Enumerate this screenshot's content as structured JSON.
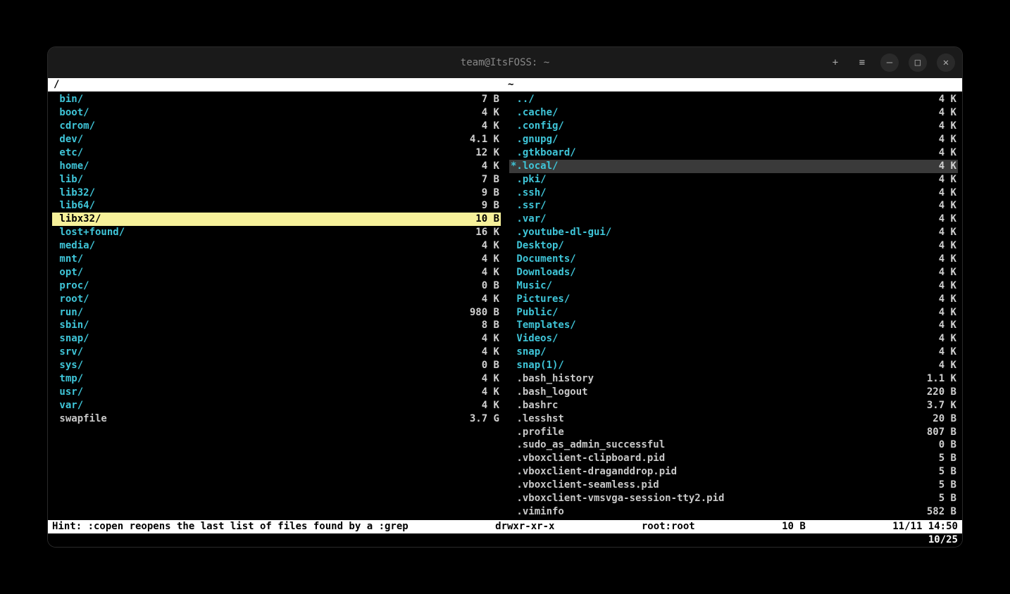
{
  "window": {
    "title": "team@ItsFOSS: ~"
  },
  "titlebar_icons": {
    "new_tab": "+",
    "menu": "≡",
    "minimize": "—",
    "maximize": "□",
    "close": "✕"
  },
  "path_bar": {
    "left": "/",
    "right": "~"
  },
  "panes": {
    "left": [
      {
        "name": "bin/",
        "size": "7 B",
        "type": "dir"
      },
      {
        "name": "boot/",
        "size": "4 K",
        "type": "dir"
      },
      {
        "name": "cdrom/",
        "size": "4 K",
        "type": "dir"
      },
      {
        "name": "dev/",
        "size": "4.1 K",
        "type": "dir"
      },
      {
        "name": "etc/",
        "size": "12 K",
        "type": "dir"
      },
      {
        "name": "home/",
        "size": "4 K",
        "type": "dir"
      },
      {
        "name": "lib/",
        "size": "7 B",
        "type": "dir"
      },
      {
        "name": "lib32/",
        "size": "9 B",
        "type": "dir"
      },
      {
        "name": "lib64/",
        "size": "9 B",
        "type": "dir"
      },
      {
        "name": "libx32/",
        "size": "10 B",
        "type": "dir",
        "selected": true
      },
      {
        "name": "lost+found/",
        "size": "16 K",
        "type": "dir"
      },
      {
        "name": "media/",
        "size": "4 K",
        "type": "dir"
      },
      {
        "name": "mnt/",
        "size": "4 K",
        "type": "dir"
      },
      {
        "name": "opt/",
        "size": "4 K",
        "type": "dir"
      },
      {
        "name": "proc/",
        "size": "0 B",
        "type": "dir"
      },
      {
        "name": "root/",
        "size": "4 K",
        "type": "dir"
      },
      {
        "name": "run/",
        "size": "980 B",
        "type": "dir"
      },
      {
        "name": "sbin/",
        "size": "8 B",
        "type": "dir"
      },
      {
        "name": "snap/",
        "size": "4 K",
        "type": "dir"
      },
      {
        "name": "srv/",
        "size": "4 K",
        "type": "dir"
      },
      {
        "name": "sys/",
        "size": "0 B",
        "type": "dir"
      },
      {
        "name": "tmp/",
        "size": "4 K",
        "type": "dir"
      },
      {
        "name": "usr/",
        "size": "4 K",
        "type": "dir"
      },
      {
        "name": "var/",
        "size": "4 K",
        "type": "dir"
      },
      {
        "name": "swapfile",
        "size": "3.7 G",
        "type": "file"
      }
    ],
    "right": [
      {
        "name": "../",
        "size": "4 K",
        "type": "dir"
      },
      {
        "name": ".cache/",
        "size": "4 K",
        "type": "dir"
      },
      {
        "name": ".config/",
        "size": "4 K",
        "type": "dir"
      },
      {
        "name": ".gnupg/",
        "size": "4 K",
        "type": "dir"
      },
      {
        "name": ".gtkboard/",
        "size": "4 K",
        "type": "dir"
      },
      {
        "name": ".local/",
        "size": "4 K",
        "type": "dir",
        "selected": true,
        "marker": "*"
      },
      {
        "name": ".pki/",
        "size": "4 K",
        "type": "dir"
      },
      {
        "name": ".ssh/",
        "size": "4 K",
        "type": "dir"
      },
      {
        "name": ".ssr/",
        "size": "4 K",
        "type": "dir"
      },
      {
        "name": ".var/",
        "size": "4 K",
        "type": "dir"
      },
      {
        "name": ".youtube-dl-gui/",
        "size": "4 K",
        "type": "dir"
      },
      {
        "name": "Desktop/",
        "size": "4 K",
        "type": "dir"
      },
      {
        "name": "Documents/",
        "size": "4 K",
        "type": "dir"
      },
      {
        "name": "Downloads/",
        "size": "4 K",
        "type": "dir"
      },
      {
        "name": "Music/",
        "size": "4 K",
        "type": "dir"
      },
      {
        "name": "Pictures/",
        "size": "4 K",
        "type": "dir"
      },
      {
        "name": "Public/",
        "size": "4 K",
        "type": "dir"
      },
      {
        "name": "Templates/",
        "size": "4 K",
        "type": "dir"
      },
      {
        "name": "Videos/",
        "size": "4 K",
        "type": "dir"
      },
      {
        "name": "snap/",
        "size": "4 K",
        "type": "dir"
      },
      {
        "name": "snap(1)/",
        "size": "4 K",
        "type": "dir"
      },
      {
        "name": ".bash_history",
        "size": "1.1 K",
        "type": "file"
      },
      {
        "name": ".bash_logout",
        "size": "220 B",
        "type": "file"
      },
      {
        "name": ".bashrc",
        "size": "3.7 K",
        "type": "file"
      },
      {
        "name": ".lesshst",
        "size": "20 B",
        "type": "file"
      },
      {
        "name": ".profile",
        "size": "807 B",
        "type": "file"
      },
      {
        "name": ".sudo_as_admin_successful",
        "size": "0 B",
        "type": "file"
      },
      {
        "name": ".vboxclient-clipboard.pid",
        "size": "5 B",
        "type": "file"
      },
      {
        "name": ".vboxclient-draganddrop.pid",
        "size": "5 B",
        "type": "file"
      },
      {
        "name": ".vboxclient-seamless.pid",
        "size": "5 B",
        "type": "file"
      },
      {
        "name": ".vboxclient-vmsvga-session-tty2.pid",
        "size": "5 B",
        "type": "file"
      },
      {
        "name": ".viminfo",
        "size": "582 B",
        "type": "file"
      }
    ]
  },
  "status": {
    "hint": "Hint: :copen reopens the last list of files found by a :grep",
    "perms": "drwxr-xr-x",
    "owner": "root:root",
    "size": "10 B",
    "date": "11/11 14:50"
  },
  "counter": "10/25"
}
